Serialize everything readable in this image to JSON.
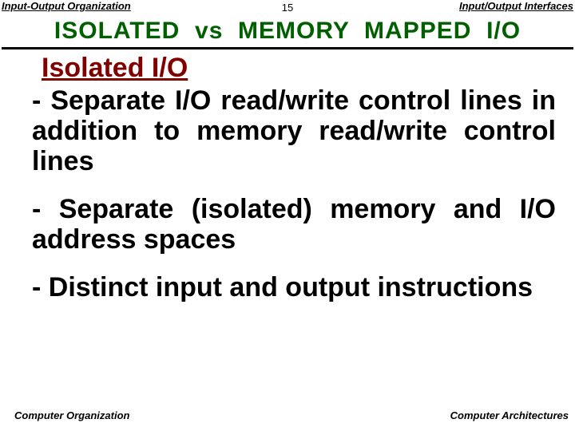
{
  "header": {
    "left": "Input-Output Organization",
    "center": "15",
    "right": "Input/Output Interfaces"
  },
  "title": "ISOLATED  vs  MEMORY  MAPPED  I/O",
  "section_heading": "Isolated I/O",
  "bullets": [
    "- Separate I/O read/write control lines in addition to memory read/write control lines",
    "- Separate (isolated) memory and I/O address spaces",
    "- Distinct input and output instructions"
  ],
  "footer": {
    "left": "Computer Organization",
    "right": "Computer Architectures"
  }
}
